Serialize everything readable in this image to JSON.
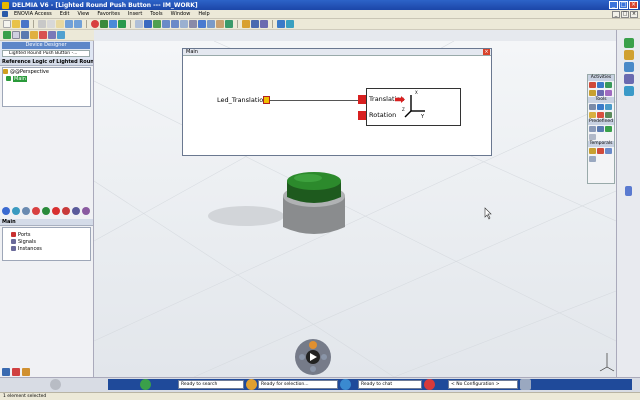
{
  "window": {
    "title": "DELMIA V6 - [Lighted Round Push Button --- IM_WORK]",
    "buttons": [
      "_",
      "□",
      "×"
    ]
  },
  "menu": {
    "items": [
      "ENOVIA Access",
      "Edit",
      "View",
      "Favorites",
      "Insert",
      "Tools",
      "Window",
      "Help"
    ]
  },
  "left_panel": {
    "designer_label": "Device Designer",
    "path_label": "Lighted Round Push Button -...",
    "header": "Reference Logic of Lighted Round Push B",
    "tree": [
      {
        "label": "@@Perspective",
        "color": "#d0a020"
      },
      {
        "label": "Main",
        "color": "#2a9a3a",
        "selected": true
      }
    ],
    "main_header": "Main",
    "main_tree": [
      {
        "label": "Ports",
        "color": "#c83030"
      },
      {
        "label": "Signals",
        "color": "#6a6a9a"
      },
      {
        "label": "Instances",
        "color": "#6a6a9a"
      }
    ]
  },
  "main_window": {
    "title": "Main",
    "input_label": "Led_Translation",
    "port_translation": "Translation",
    "port_rotation": "Rotation",
    "axis_x": "X",
    "axis_y": "Y",
    "axis_z": "Z"
  },
  "palette": {
    "sections": [
      "Activities",
      "Tools",
      "Predefined",
      "Temporals"
    ]
  },
  "bottom": {
    "search_placeholder": "Ready to search",
    "selection_text": "Ready for selection...",
    "chat_text": "Ready to chat",
    "config_text": "< No Configuration >"
  },
  "status": {
    "text": "1 element selected"
  },
  "colors": {
    "title_blue": "#1c46a8",
    "button_green": "#1f6e20",
    "port_red": "#d82020",
    "port_yellow": "#f0c000"
  }
}
